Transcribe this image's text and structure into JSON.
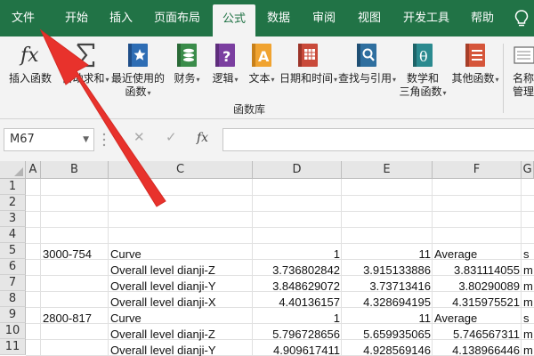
{
  "tabs": [
    {
      "label": "文件",
      "active": false
    },
    {
      "label": "开始",
      "active": false
    },
    {
      "label": "插入",
      "active": false
    },
    {
      "label": "页面布局",
      "active": false
    },
    {
      "label": "公式",
      "active": true
    },
    {
      "label": "数据",
      "active": false
    },
    {
      "label": "审阅",
      "active": false
    },
    {
      "label": "视图",
      "active": false
    },
    {
      "label": "开发工具",
      "active": false
    },
    {
      "label": "帮助",
      "active": false
    }
  ],
  "ribbon": {
    "group_label": "函数库",
    "buttons": [
      {
        "line1": "插入函数",
        "line2": "",
        "icon": "insert-function-icon"
      },
      {
        "line1": "自动求和",
        "line2": "",
        "icon": "autosum-icon"
      },
      {
        "line1": "最近使用的",
        "line2": "函数",
        "icon": "recently-used-icon"
      },
      {
        "line1": "财务",
        "line2": "",
        "icon": "financial-icon"
      },
      {
        "line1": "逻辑",
        "line2": "",
        "icon": "logical-icon"
      },
      {
        "line1": "文本",
        "line2": "",
        "icon": "text-icon"
      },
      {
        "line1": "日期和时间",
        "line2": "",
        "icon": "date-time-icon"
      },
      {
        "line1": "查找与引用",
        "line2": "",
        "icon": "lookup-reference-icon"
      },
      {
        "line1": "数学和",
        "line2": "三角函数",
        "icon": "math-trig-icon"
      },
      {
        "line1": "其他函数",
        "line2": "",
        "icon": "more-functions-icon"
      },
      {
        "line1": "名称",
        "line2": "管理",
        "icon": "name-manager-icon"
      }
    ]
  },
  "formula_bar": {
    "name_box": "M67",
    "fx_label": "fx",
    "formula": ""
  },
  "columns": [
    "A",
    "B",
    "C",
    "D",
    "E",
    "F",
    "G"
  ],
  "rows": [
    {
      "num": "1",
      "cells": [
        "",
        "",
        "",
        "",
        "",
        "",
        ""
      ]
    },
    {
      "num": "2",
      "cells": [
        "",
        "",
        "",
        "",
        "",
        "",
        ""
      ]
    },
    {
      "num": "3",
      "cells": [
        "",
        "",
        "",
        "",
        "",
        "",
        ""
      ]
    },
    {
      "num": "4",
      "cells": [
        "",
        "",
        "",
        "",
        "",
        "",
        ""
      ]
    },
    {
      "num": "5",
      "cells": [
        "",
        "3000-754",
        "Curve",
        "1",
        "11",
        "Average",
        "s"
      ]
    },
    {
      "num": "6",
      "cells": [
        "",
        "",
        "Overall level dianji-Z",
        "3.736802842",
        "3.915133886",
        "3.831114055",
        "m"
      ]
    },
    {
      "num": "7",
      "cells": [
        "",
        "",
        "Overall level dianji-Y",
        "3.848629072",
        "3.73713416",
        "3.80290089",
        "m"
      ]
    },
    {
      "num": "8",
      "cells": [
        "",
        "",
        "Overall level dianji-X",
        "4.40136157",
        "4.328694195",
        "4.315975521",
        "m"
      ]
    },
    {
      "num": "9",
      "cells": [
        "",
        "2800-817",
        "Curve",
        "1",
        "11",
        "Average",
        "s"
      ]
    },
    {
      "num": "10",
      "cells": [
        "",
        "",
        "Overall level dianji-Z",
        "5.796728656",
        "5.659935065",
        "5.746567311",
        "m"
      ]
    },
    {
      "num": "11",
      "cells": [
        "",
        "",
        "Overall level dianji-Y",
        "4.909617411",
        "4.928569146",
        "4.138966446",
        "m"
      ]
    }
  ],
  "colors": {
    "tab_bar": "#217346",
    "ribbon_bg": "#f3f3f3",
    "arrow": "#e8322c"
  }
}
